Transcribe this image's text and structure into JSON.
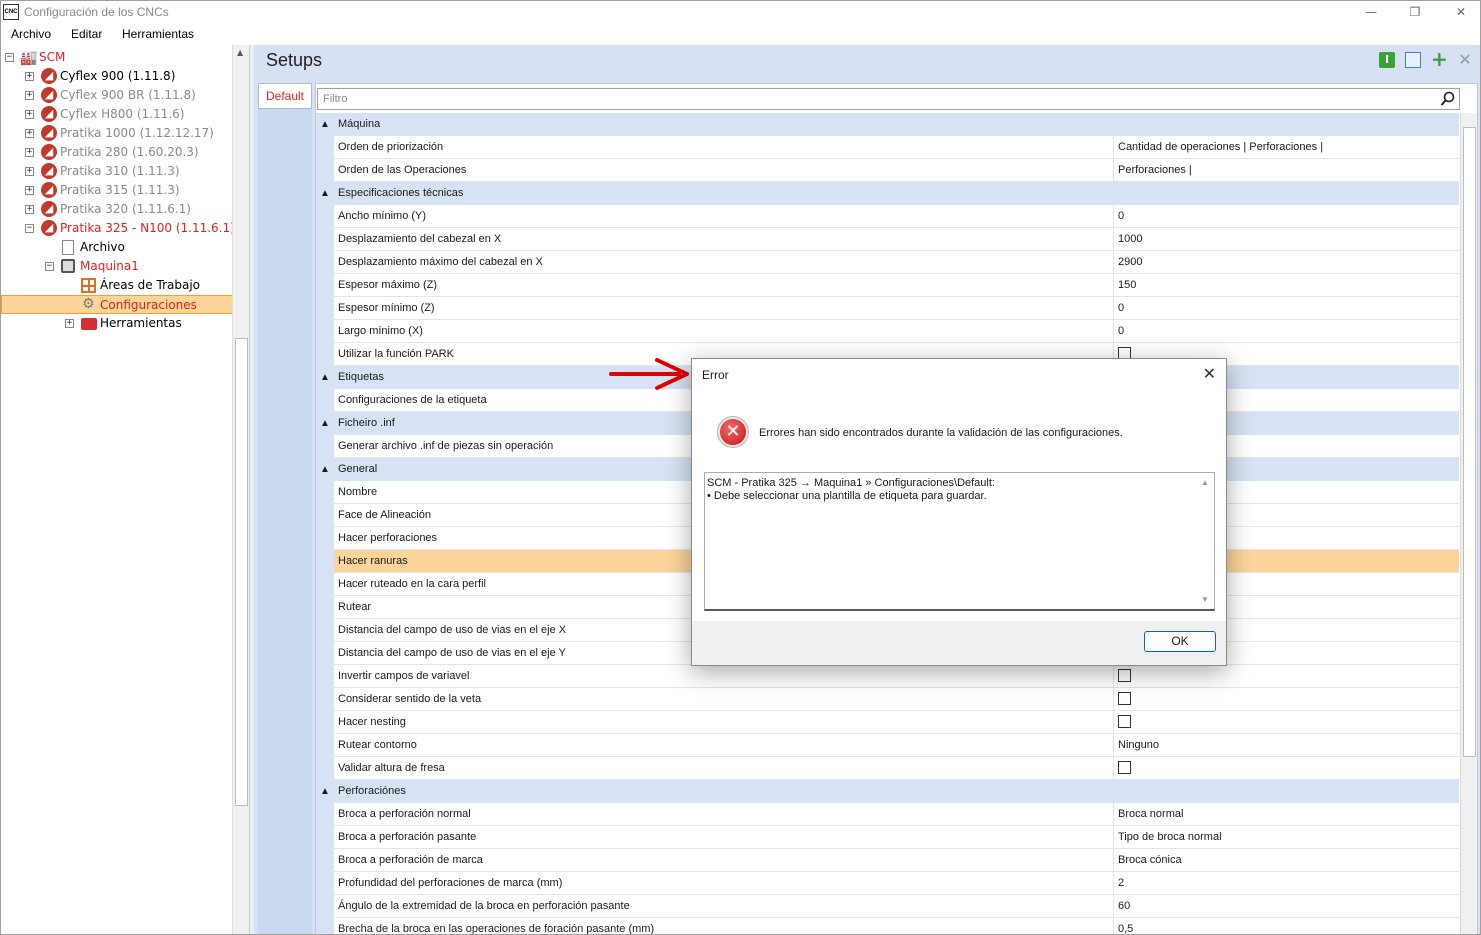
{
  "window": {
    "title": "Configuración de los CNCs",
    "app_icon": "CNC",
    "minimize": "—",
    "maximize": "❐",
    "close": "✕"
  },
  "menu": [
    "Archivo",
    "Editar",
    "Herramientas"
  ],
  "tree": {
    "root": "SCM",
    "machines": [
      {
        "label": "Cyflex 900 (1.11.8)",
        "color": "#000000"
      },
      {
        "label": "Cyflex 900 BR (1.11.8)",
        "color": "#8a8a8a"
      },
      {
        "label": "Cyflex H800 (1.11.6)",
        "color": "#8a8a8a"
      },
      {
        "label": "Pratika 1000 (1.12.12.17)",
        "color": "#8a8a8a"
      },
      {
        "label": "Pratika 280 (1.60.20.3)",
        "color": "#8a8a8a"
      },
      {
        "label": "Pratika 310 (1.11.3)",
        "color": "#8a8a8a"
      },
      {
        "label": "Pratika 315 (1.11.3)",
        "color": "#8a8a8a"
      },
      {
        "label": "Pratika 320 (1.11.6.1)",
        "color": "#8a8a8a"
      },
      {
        "label": "Pratika 325 - N100 (1.11.6.1)",
        "color": "#e02020"
      }
    ],
    "archivo": "Archivo",
    "maquina": "Maquina1",
    "areas": "Áreas de Trabajo",
    "configuraciones": "Configuraciones",
    "herramientas": "Herramientas"
  },
  "setups": {
    "title": "Setups",
    "tab": "Default",
    "filter_placeholder": "Filtro"
  },
  "grid": [
    {
      "type": "cat",
      "name": "Máquina"
    },
    {
      "type": "item",
      "name": "Orden de priorización",
      "value": "Cantidad de operaciones | Perforaciones |"
    },
    {
      "type": "item",
      "name": "Orden de las Operaciones",
      "value": "Perforaciones |"
    },
    {
      "type": "cat",
      "name": "Especificaciones técnicas"
    },
    {
      "type": "item",
      "name": "Ancho mínimo (Y)",
      "value": "0"
    },
    {
      "type": "item",
      "name": "Desplazamiento del cabezal en X",
      "value": "1000"
    },
    {
      "type": "item",
      "name": "Desplazamiento máximo del cabezal en X",
      "value": "2900"
    },
    {
      "type": "item",
      "name": "Espesor máximo (Z)",
      "value": "150"
    },
    {
      "type": "item",
      "name": "Espesor mínimo (Z)",
      "value": "0"
    },
    {
      "type": "item",
      "name": "Largo mínimo (X)",
      "value": "0"
    },
    {
      "type": "item",
      "name": "Utilizar la función PARK",
      "value": "",
      "checkbox": true
    },
    {
      "type": "cat",
      "name": "Etiquetas"
    },
    {
      "type": "item",
      "name": "Configuraciones de la etiqueta",
      "value": ""
    },
    {
      "type": "cat",
      "name": "Ficheiro .inf"
    },
    {
      "type": "item",
      "name": "Generar archivo .inf de piezas sin operación",
      "value": ""
    },
    {
      "type": "cat",
      "name": "General"
    },
    {
      "type": "item",
      "name": "Nombre",
      "value": ""
    },
    {
      "type": "item",
      "name": "Face de Alineación",
      "value": ""
    },
    {
      "type": "item",
      "name": "Hacer perforaciones",
      "value": ""
    },
    {
      "type": "item",
      "name": "Hacer ranuras",
      "value": "",
      "selected": true
    },
    {
      "type": "item",
      "name": "Hacer ruteado en la cara perfil",
      "value": ""
    },
    {
      "type": "item",
      "name": "Rutear",
      "value": ""
    },
    {
      "type": "item",
      "name": "Distancia del campo de uso de vias en el eje X",
      "value": ""
    },
    {
      "type": "item",
      "name": "Distancia del campo de uso de vias en el eje Y",
      "value": ""
    },
    {
      "type": "item",
      "name": "Invertir campos de variavel",
      "value": "",
      "checkbox": true
    },
    {
      "type": "item",
      "name": "Considerar sentido de la veta",
      "value": "",
      "checkbox": true
    },
    {
      "type": "item",
      "name": "Hacer nesting",
      "value": "",
      "checkbox": true
    },
    {
      "type": "item",
      "name": "Rutear contorno",
      "value": "Ninguno"
    },
    {
      "type": "item",
      "name": "Validar altura de fresa",
      "value": "",
      "checkbox": true
    },
    {
      "type": "cat",
      "name": "Perforaciónes"
    },
    {
      "type": "item",
      "name": "Broca a perforación normal",
      "value": "Broca normal"
    },
    {
      "type": "item",
      "name": "Broca a perforación pasante",
      "value": "Tipo de broca normal"
    },
    {
      "type": "item",
      "name": "Broca a perforación de marca",
      "value": "Broca cónica"
    },
    {
      "type": "item",
      "name": "Profundidad del perforaciones de marca (mm)",
      "value": "2"
    },
    {
      "type": "item",
      "name": "Ángulo de la extremidad de la broca en perforación pasante",
      "value": "60"
    },
    {
      "type": "item",
      "name": "Brecha de la broca en las operaciones de foración pasante (mm)",
      "value": "0,5"
    }
  ],
  "dialog": {
    "title": "Error",
    "message": "Errores han sido encontrados durante la validación de las configuraciones.",
    "details_line1": "SCM - Pratika 325 → Maquina1 » Configuraciones\\Default:",
    "details_line2": "• Debe seleccionar una plantilla de etiqueta para guardar.",
    "ok": "OK"
  },
  "colors": {
    "accent_red": "#e02020",
    "selection": "#fbd59a",
    "category": "#d7e3f4",
    "arrow": "#e00000"
  }
}
